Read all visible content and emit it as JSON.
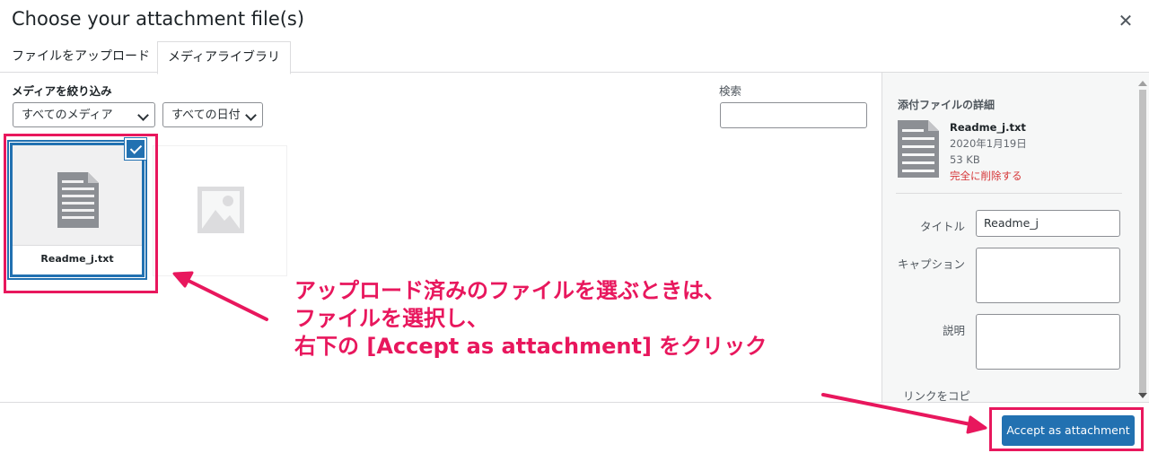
{
  "dialog": {
    "title": "Choose your attachment file(s)",
    "close_icon": "close-icon"
  },
  "tabs": [
    {
      "label": "ファイルをアップロード",
      "active": false
    },
    {
      "label": "メディアライブラリ",
      "active": true
    }
  ],
  "filters": {
    "label": "メディアを絞り込み",
    "media_type": "すべてのメディア",
    "date": "すべての日付"
  },
  "search": {
    "label": "検索",
    "value": ""
  },
  "attachments": [
    {
      "name": "Readme_j.txt",
      "selected": true,
      "icon": "document-icon"
    },
    {
      "name": "",
      "selected": false,
      "icon": "image-placeholder-icon"
    }
  ],
  "annotation": {
    "lines": [
      "アップロード済みのファイルを選ぶときは、",
      "ファイルを選択し、",
      "右下の [Accept as attachment] をクリック"
    ],
    "color": "#e8175d"
  },
  "details": {
    "heading": "添付ファイルの詳細",
    "filename": "Readme_j.txt",
    "date": "2020年1月19日",
    "size": "53 KB",
    "delete_label": "完全に削除する",
    "title_label": "タイトル",
    "title_value": "Readme_j",
    "caption_label": "キャプション",
    "caption_value": "",
    "description_label": "説明",
    "description_value": "",
    "copy_link_label": "リンクをコピ"
  },
  "footer": {
    "accept_label": "Accept as attachment"
  },
  "colors": {
    "accent": "#2271b1",
    "danger": "#d63638",
    "highlight": "#e8175d"
  }
}
